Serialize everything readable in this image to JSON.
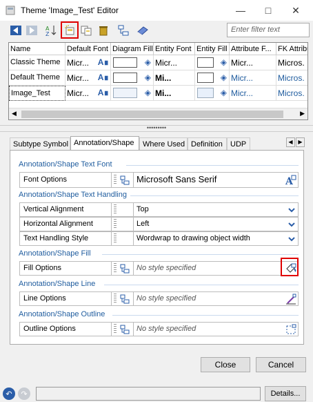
{
  "window": {
    "title": "Theme 'Image_Test' Editor"
  },
  "toolbar": {
    "filter_placeholder": "Enter filter text"
  },
  "grid": {
    "columns": [
      "Name",
      "Default Font",
      "Diagram Fill",
      "Entity Font",
      "Entity Fill",
      "Attribute F...",
      "FK Attribu"
    ],
    "rows": [
      {
        "name": "Classic Theme",
        "default_font": "Micr...",
        "entity_font": "Micr...",
        "attr_font": "Micr...",
        "fk_font": "Micros."
      },
      {
        "name": "Default Theme",
        "default_font": "Micr...",
        "entity_font": "Mi...",
        "attr_font": "Micr...",
        "fk_font": "Micros."
      },
      {
        "name": "Image_Test",
        "default_font": "Micr...",
        "entity_font": "Mi...",
        "attr_font": "Micr...",
        "fk_font": "Micros."
      }
    ]
  },
  "splitter": "•••••••••",
  "tabs": [
    "Subtype Symbol",
    "Annotation/Shape",
    "Where Used",
    "Definition",
    "UDP"
  ],
  "sections": {
    "font": {
      "title": "Annotation/Shape Text Font",
      "label": "Font Options",
      "value": "Microsoft Sans Serif"
    },
    "handling": {
      "title": "Annotation/Shape Text Handling",
      "rows": [
        {
          "label": "Vertical Alignment",
          "value": "Top"
        },
        {
          "label": "Horizontal Alignment",
          "value": "Left"
        },
        {
          "label": "Text Handling Style",
          "value": "Wordwrap to drawing object width"
        }
      ]
    },
    "fill": {
      "title": "Annotation/Shape Fill",
      "label": "Fill Options",
      "value": "No style specified"
    },
    "line": {
      "title": "Annotation/Shape Line",
      "label": "Line Options",
      "value": "No style specified"
    },
    "outline": {
      "title": "Annotation/Shape Outline",
      "label": "Outline Options",
      "value": "No style specified"
    }
  },
  "buttons": {
    "close": "Close",
    "cancel": "Cancel",
    "details": "Details..."
  },
  "colors": {
    "accent_blue": "#1f5c9e",
    "highlight_red": "#e00000"
  }
}
